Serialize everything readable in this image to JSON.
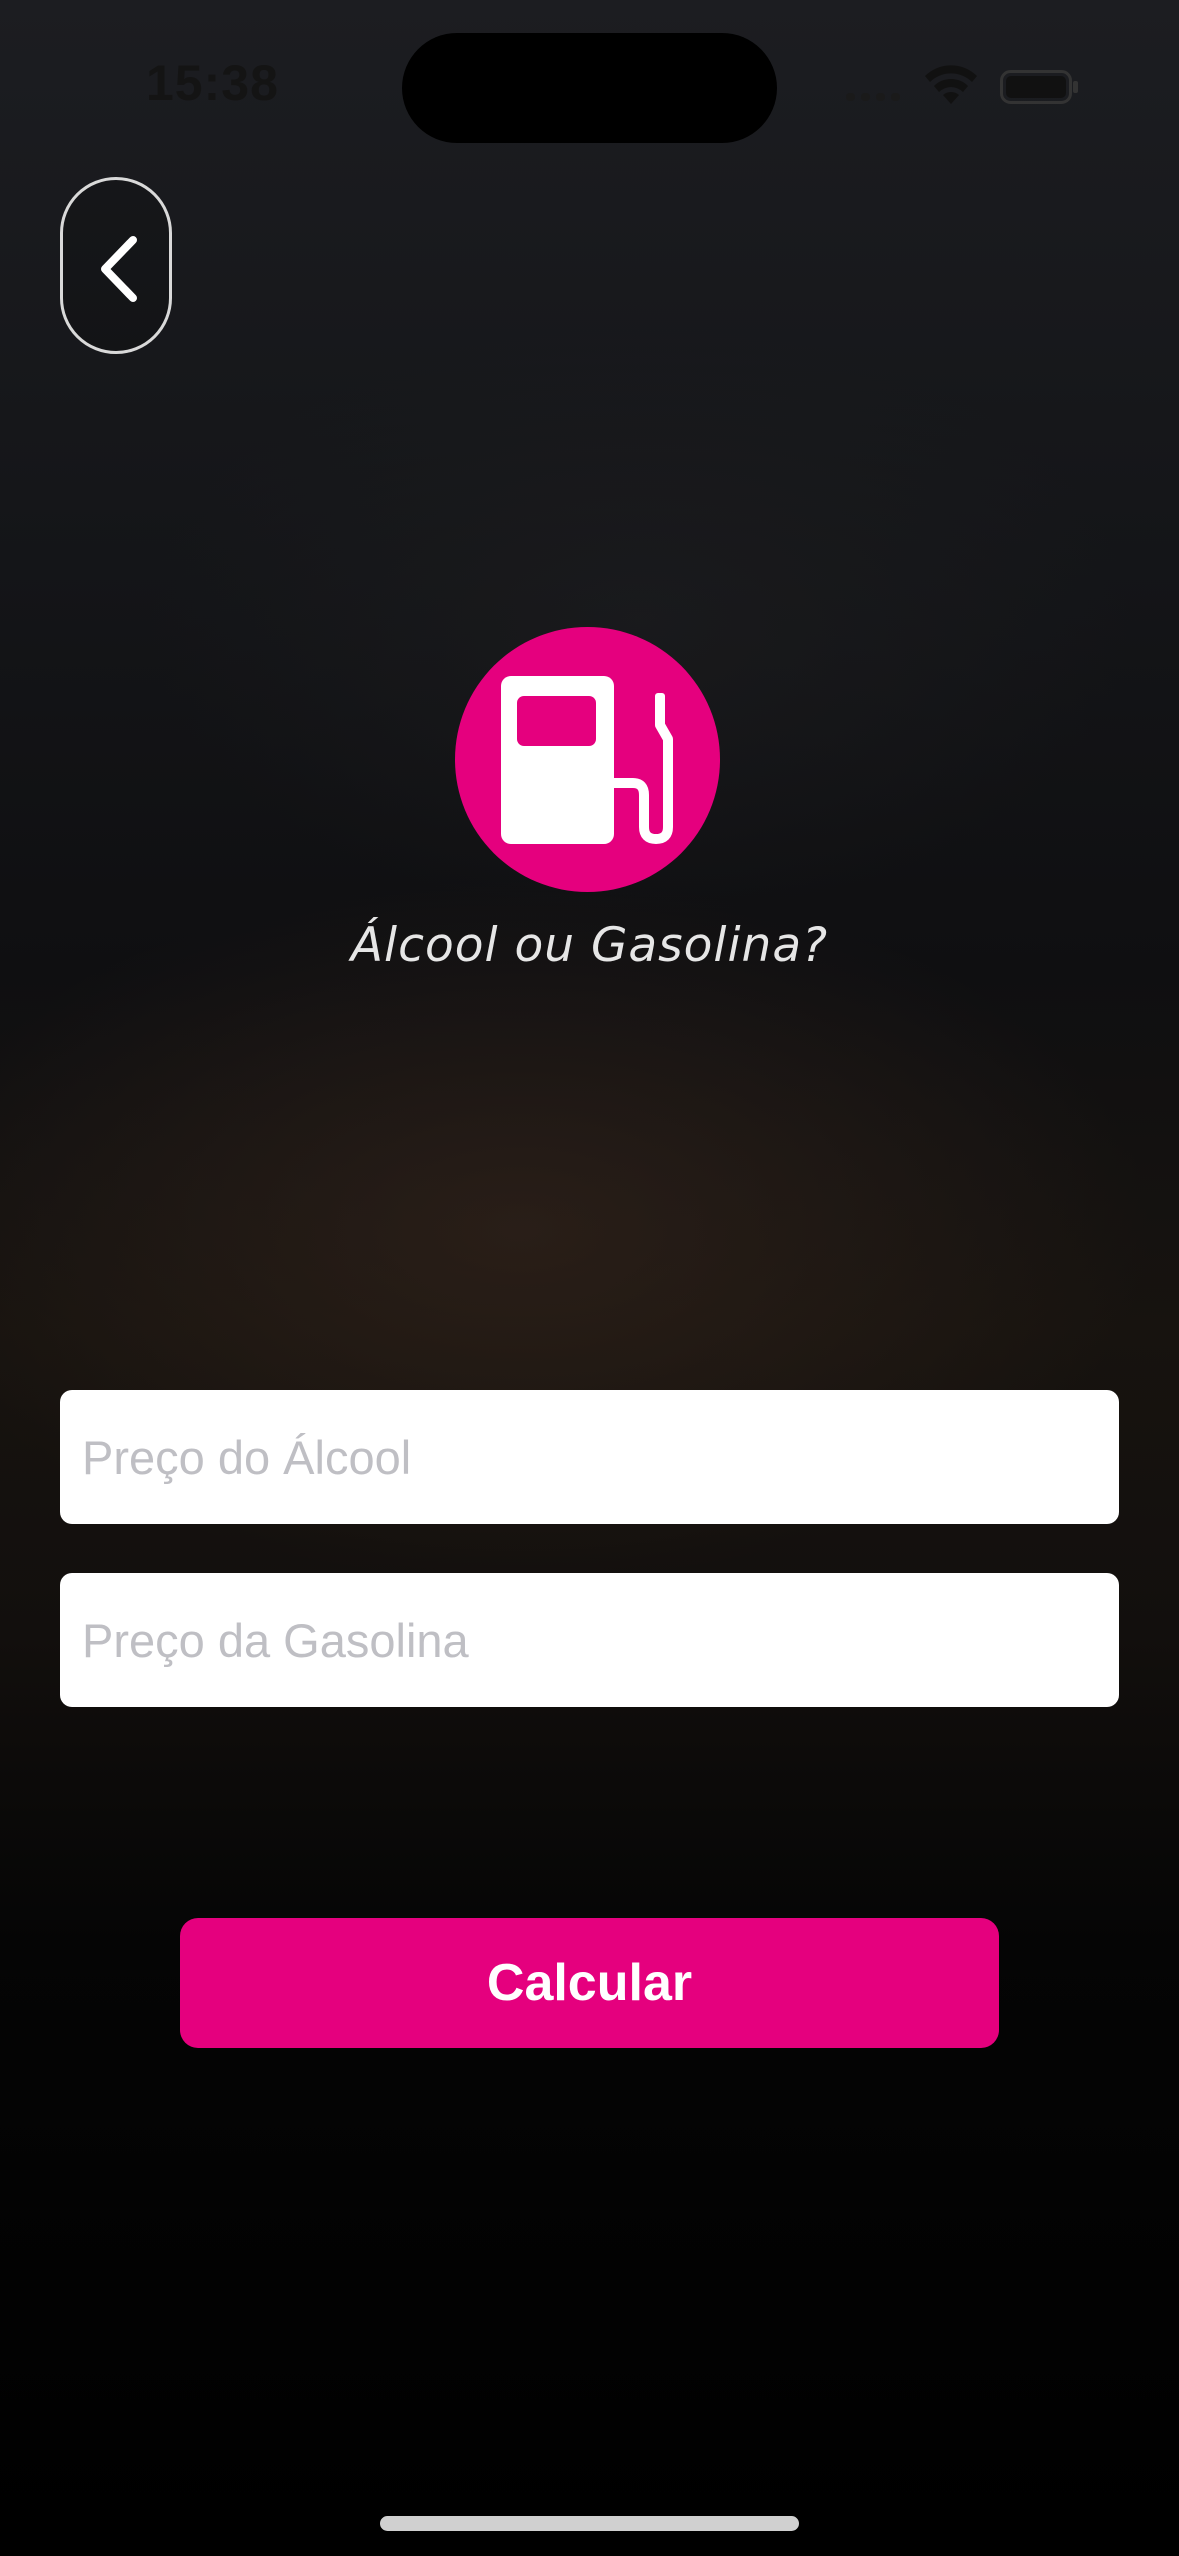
{
  "status_bar": {
    "time": "15:38",
    "icons": [
      "cell-signal-icon",
      "wifi-icon",
      "battery-icon"
    ]
  },
  "header": {
    "back_icon": "chevron-left-icon"
  },
  "logo": {
    "icon": "fuel-pump-icon",
    "title": "Álcool ou Gasolina?"
  },
  "form": {
    "alcool_placeholder": "Preço do Álcool",
    "alcool_value": "",
    "gasolina_placeholder": "Preço da Gasolina",
    "gasolina_value": "",
    "calculate_label": "Calcular"
  },
  "colors": {
    "accent": "#e5007e",
    "background": "#000000",
    "title_text": "#e6e6e6"
  }
}
